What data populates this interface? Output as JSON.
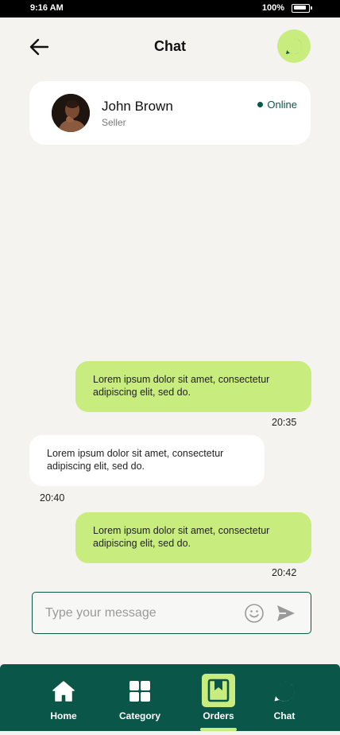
{
  "status_bar": {
    "time": "9:16 AM",
    "battery": "100%"
  },
  "header": {
    "title": "Chat",
    "back_icon": "arrow-left-icon",
    "action_icon": "chat-bubble-icon"
  },
  "contact": {
    "name": "John Brown",
    "role": "Seller",
    "status": "Online"
  },
  "messages": [
    {
      "side": "sent",
      "text": "Lorem ipsum dolor sit amet, consectetur adipiscing elit, sed do.",
      "time": "20:35"
    },
    {
      "side": "received",
      "text": "Lorem ipsum dolor sit amet, consectetur adipiscing elit, sed do.",
      "time": "20:40"
    },
    {
      "side": "sent",
      "text": "Lorem ipsum dolor sit amet, consectetur adipiscing elit, sed do.",
      "time": "20:42"
    }
  ],
  "composer": {
    "placeholder": "Type your message",
    "value": ""
  },
  "nav": {
    "items": [
      {
        "label": "Home",
        "icon": "home-icon",
        "active": false
      },
      {
        "label": "Category",
        "icon": "grid-icon",
        "active": false
      },
      {
        "label": "Orders",
        "icon": "bookmark-icon",
        "active": true
      },
      {
        "label": "Chat",
        "icon": "chat-bubble-icon",
        "active": false
      }
    ]
  },
  "colors": {
    "accent": "#c9ec7f",
    "primary": "#0a5649",
    "background": "#f4f3ef"
  }
}
